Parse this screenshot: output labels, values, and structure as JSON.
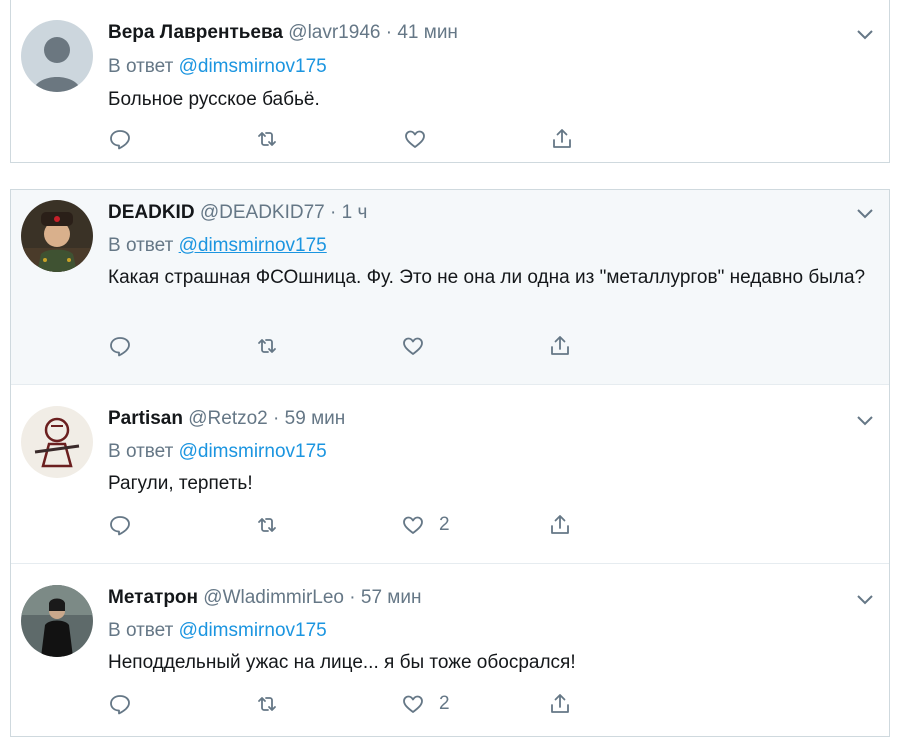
{
  "tweets": [
    {
      "name": "Вера Лаврентьева",
      "handle": "@lavr1946",
      "time": "41 мин",
      "reply_prefix": "В ответ",
      "reply_to": "@dimsmirnov175",
      "text": "Больное русское бабьё.",
      "likes": ""
    },
    {
      "name": "DEADKID",
      "handle": "@DEADKID77",
      "time": "1 ч",
      "reply_prefix": "В ответ",
      "reply_to": "@dimsmirnov175",
      "text": "Какая страшная ФСОшница. Фу. Это не она ли одна из \"металлургов\" недавно была?",
      "likes": ""
    },
    {
      "name": "Partisan",
      "handle": "@Retzo2",
      "time": "59 мин",
      "reply_prefix": "В ответ",
      "reply_to": "@dimsmirnov175",
      "text": "Рагули, терпеть!",
      "likes": "2"
    },
    {
      "name": "Метатрон",
      "handle": "@WladimmirLeo",
      "time": "57 мин",
      "reply_prefix": "В ответ",
      "reply_to": "@dimsmirnov175",
      "text": "Неподдельный ужас на лице... я бы тоже обосрался!",
      "likes": "2"
    }
  ],
  "separator": "·",
  "icons": [
    "reply-icon",
    "retweet-icon",
    "like-icon",
    "share-icon",
    "chevron-down-icon"
  ],
  "colors": {
    "link": "#1b95e0",
    "muted": "#657786",
    "text": "#14171a",
    "border": "#cfd9de"
  }
}
